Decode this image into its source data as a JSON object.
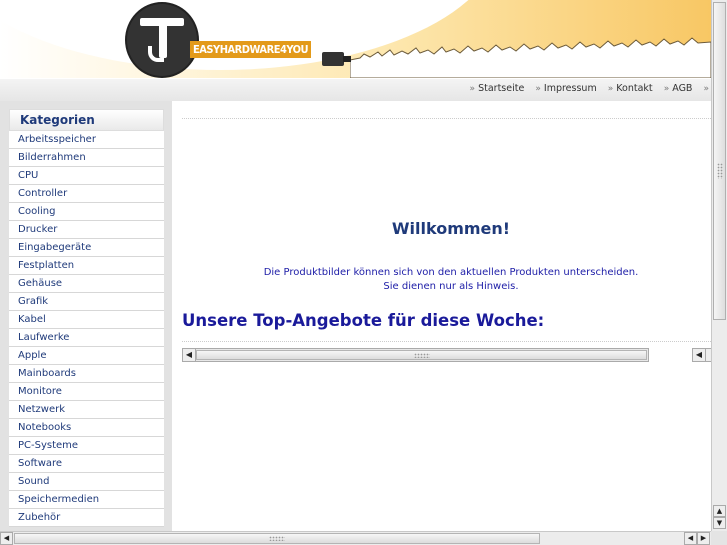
{
  "header": {
    "logo_text": "EASYHARDWARE4YOU"
  },
  "nav": {
    "items": [
      {
        "label": "Startseite"
      },
      {
        "label": "Impressum"
      },
      {
        "label": "Kontakt"
      },
      {
        "label": "AGB"
      }
    ],
    "arrow_glyph": "»"
  },
  "sidebar": {
    "title": "Kategorien",
    "categories": [
      "Arbeitsspeicher",
      "Bilderrahmen",
      "CPU",
      "Controller",
      "Cooling",
      "Drucker",
      "Eingabegeräte",
      "Festplatten",
      "Gehäuse",
      "Grafik",
      "Kabel",
      "Laufwerke",
      "Apple",
      "Mainboards",
      "Monitore",
      "Netzwerk",
      "Notebooks",
      "PC-Systeme",
      "Software",
      "Sound",
      "Speichermedien",
      "Zubehör"
    ]
  },
  "main": {
    "welcome": "Willkommen!",
    "hint_line1": "Die Produktbilder können sich von den aktuellen Produkten unterscheiden.",
    "hint_line2": "Sie dienen nur als Hinweis.",
    "top_offers_title": "Unsere Top-Angebote für diese Woche:"
  },
  "colors": {
    "accent_orange": "#e39a1a",
    "link_blue": "#1f3a7a",
    "heading_blue": "#1a1a9a"
  },
  "icons": {
    "scroll_left": "◀",
    "scroll_right": "▶",
    "scroll_up": "▲",
    "scroll_down": "▼"
  }
}
